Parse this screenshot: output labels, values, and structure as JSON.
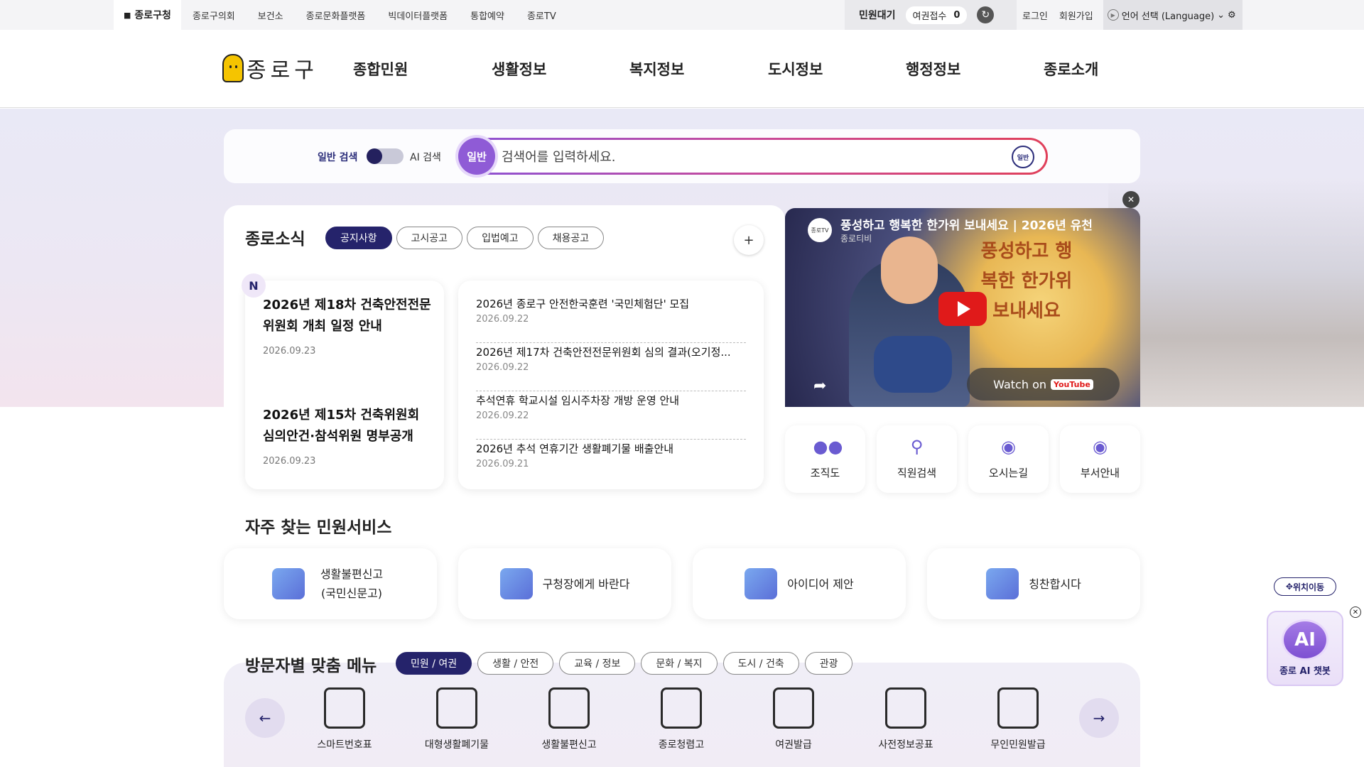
{
  "topbar": {
    "home_label": "종로구청",
    "links": [
      "종로구의회",
      "보건소",
      "종로문화플랫폼",
      "빅데이터플랫폼",
      "통합예약",
      "종로TV"
    ],
    "civil_label": "민원대기",
    "passport_label": "여권접수",
    "passport_count": "0",
    "login": "로그인",
    "signup": "회원가입",
    "language": "언어 선택 (Language)"
  },
  "header": {
    "logo_text": "종로구",
    "menu": [
      "종합민원",
      "생활정보",
      "복지정보",
      "도시정보",
      "행정정보",
      "종로소개"
    ]
  },
  "search": {
    "toggle_normal": "일반 검색",
    "toggle_ai": "AI 검색",
    "badge": "일반",
    "placeholder": "검색어를 입력하세요.",
    "button": "일반"
  },
  "news": {
    "title": "종로소식",
    "tabs": [
      "공지사항",
      "고시공고",
      "입법예고",
      "채용공고"
    ],
    "plus": "+",
    "new_badge": "N",
    "featured": [
      {
        "title": "2026년 제18차 건축안전전문위원회 개최 일정 안내",
        "date": "2026.09.23"
      },
      {
        "title": "2026년 제15차 건축위원회 심의안건·참석위원 명부공개",
        "date": "2026.09.23"
      }
    ],
    "list": [
      {
        "title": "2026년 종로구 안전한국훈련 '국민체험단' 모집",
        "date": "2026.09.22"
      },
      {
        "title": "2026년 제17차 건축안전전문위원회 심의 결과(오기정...",
        "date": "2026.09.22"
      },
      {
        "title": "추석연휴 학교시설 임시주차장 개방 운영 안내",
        "date": "2026.09.22"
      },
      {
        "title": "2026년 추석 연휴기간 생활폐기물 배출안내",
        "date": "2026.09.21"
      }
    ]
  },
  "video": {
    "title": "풍성하고 행복한 한가위 보내세요 | 2026년 유천",
    "channel": "종로티비",
    "avatar": "종로TV",
    "calligraphy": "풍성하고 행복한 한가위 보내세요",
    "watch": "Watch on",
    "yt": "YouTube"
  },
  "quick_links": [
    "조직도",
    "직원검색",
    "오시는길",
    "부서안내"
  ],
  "frequent": {
    "title": "자주 찾는 민원서비스",
    "items": [
      "생활불편신고 (국민신문고)",
      "구청장에게 바란다",
      "아이디어 제안",
      "칭찬합시다"
    ]
  },
  "visitor": {
    "title": "방문자별 맞춤 메뉴",
    "tabs": [
      "민원 / 여권",
      "생활 / 안전",
      "교육 / 정보",
      "문화 / 복지",
      "도시 / 건축",
      "관광"
    ],
    "items": [
      "스마트번호표",
      "대형생활폐기물",
      "생활불편신고",
      "종로청렴고",
      "여권발급",
      "사전정보공표",
      "무인민원발급"
    ]
  },
  "floating": {
    "location": "위치이동",
    "ai_text": "AI",
    "ai_label": "종로 AI 챗봇"
  },
  "colors": {
    "navy": "#25236b",
    "accent_purple": "#8f5bd6",
    "accent_red": "#e0405a"
  }
}
